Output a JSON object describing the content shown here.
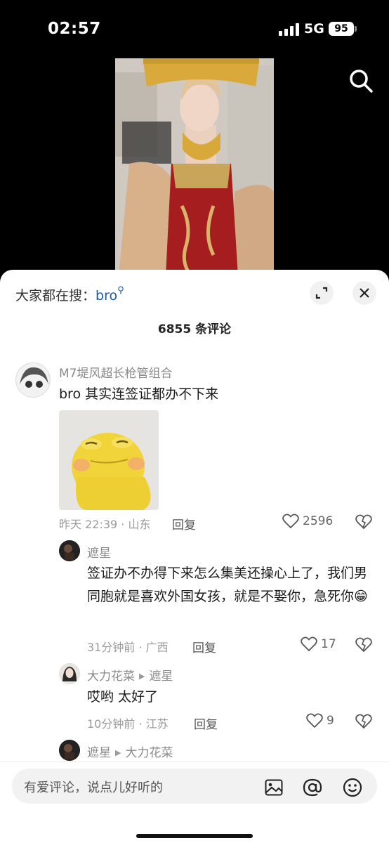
{
  "status": {
    "time": "02:57",
    "network": "5G",
    "battery": "95"
  },
  "sheet": {
    "hot_search_label": "大家都在搜：",
    "hot_search_keyword": "bro",
    "comment_count": "6855 条评论"
  },
  "comments": [
    {
      "user": "M7堤风超长枪管组合",
      "text": "bro 其实连签证都办不下来",
      "meta": "昨天 22:39 · 山东",
      "reply": "回复",
      "likes": "2596"
    },
    {
      "user": "遮星",
      "text": "签证办不办得下来怎么集美还操心上了，我们男同胞就是喜欢外国女孩，就是不娶你，急死你",
      "emoji": "😁",
      "meta": "31分钟前 · 广西",
      "reply": "回复",
      "likes": "17"
    },
    {
      "user": "大力花菜",
      "reply_to": "遮星",
      "text": "哎哟 太好了",
      "meta": "10分钟前 · 江苏",
      "reply": "回复",
      "likes": "9"
    },
    {
      "user": "遮星",
      "reply_to": "大力花菜"
    }
  ],
  "input": {
    "placeholder": "有爱评论，说点儿好听的"
  }
}
